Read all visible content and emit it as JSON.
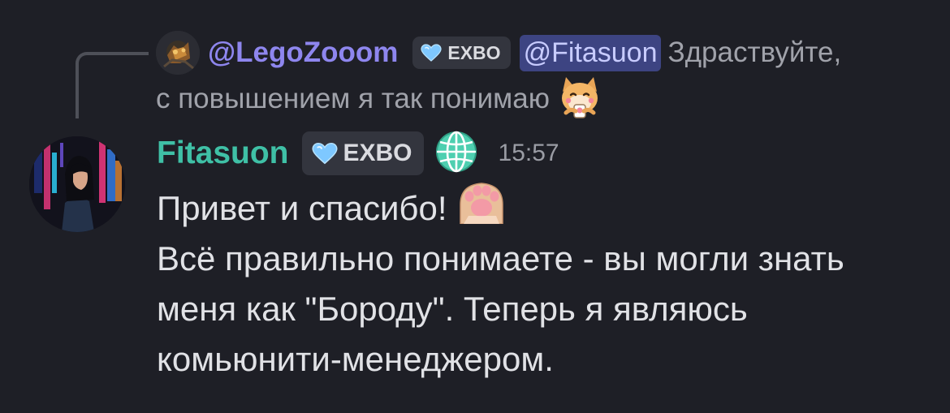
{
  "reply": {
    "author": "@LegoZooom",
    "badge": "EXBO",
    "mention": "@Fitasuon",
    "text_part1": "Здраствуйте,",
    "text_part2": "с повышением я так понимаю",
    "emoji_icon": "cat-emoji-icon"
  },
  "message": {
    "author": "Fitasuon",
    "badge": "EXBO",
    "globe_icon": "globe-icon",
    "timestamp": "15:57",
    "line1": "Привет и спасибо!",
    "line1_emoji_icon": "paw-emoji-icon",
    "line2": "Всё правильно понимаете - вы могли знать",
    "line3": "меня как \"Бороду\". Теперь я являюсь",
    "line4": "комьюнити-менеджером."
  },
  "colors": {
    "background": "#1e1f26",
    "author_main": "#3fc0a6",
    "author_reply": "#8e86ee",
    "mention_bg": "#3d4482",
    "badge_bg": "#33353e",
    "heart": "#7ec8ff"
  }
}
